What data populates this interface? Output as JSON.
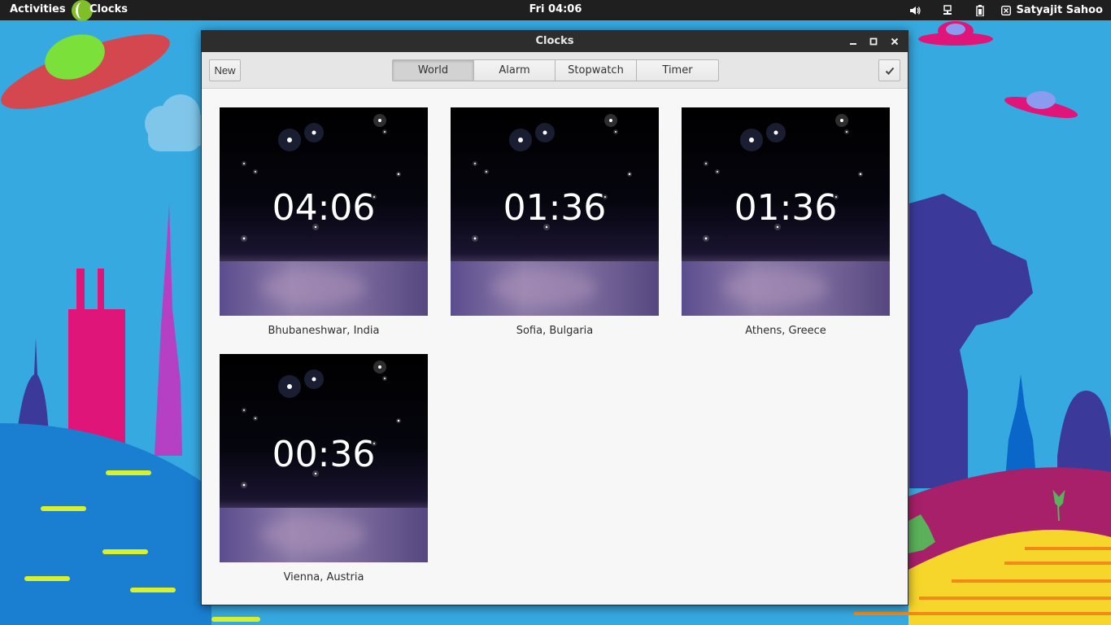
{
  "topbar": {
    "activities": "Activities",
    "app_name": "Clocks",
    "clock": "Fri 04:06",
    "user": "Satyajit Sahoo"
  },
  "window": {
    "title": "Clocks",
    "new_label": "New",
    "tabs": [
      {
        "label": "World",
        "active": true
      },
      {
        "label": "Alarm",
        "active": false
      },
      {
        "label": "Stopwatch",
        "active": false
      },
      {
        "label": "Timer",
        "active": false
      }
    ]
  },
  "clocks": [
    {
      "time": "04:06",
      "city": "Bhubaneshwar, India"
    },
    {
      "time": "01:36",
      "city": "Sofia, Bulgaria"
    },
    {
      "time": "01:36",
      "city": "Athens, Greece"
    },
    {
      "time": "00:36",
      "city": "Vienna, Austria"
    }
  ],
  "colors": {
    "topbar_bg": "#1f1f1f",
    "titlebar_bg": "#2d2d2d",
    "sky": "#36a9e0",
    "app_icon": "#7fbf2a"
  },
  "icons": {
    "app": "clock-app-icon",
    "volume": "volume-icon",
    "network": "network-wired-icon",
    "battery": "battery-icon",
    "user": "user-status-icon",
    "minimize": "minimize-icon",
    "maximize": "maximize-icon",
    "close": "close-icon",
    "select": "checkmark-icon"
  }
}
